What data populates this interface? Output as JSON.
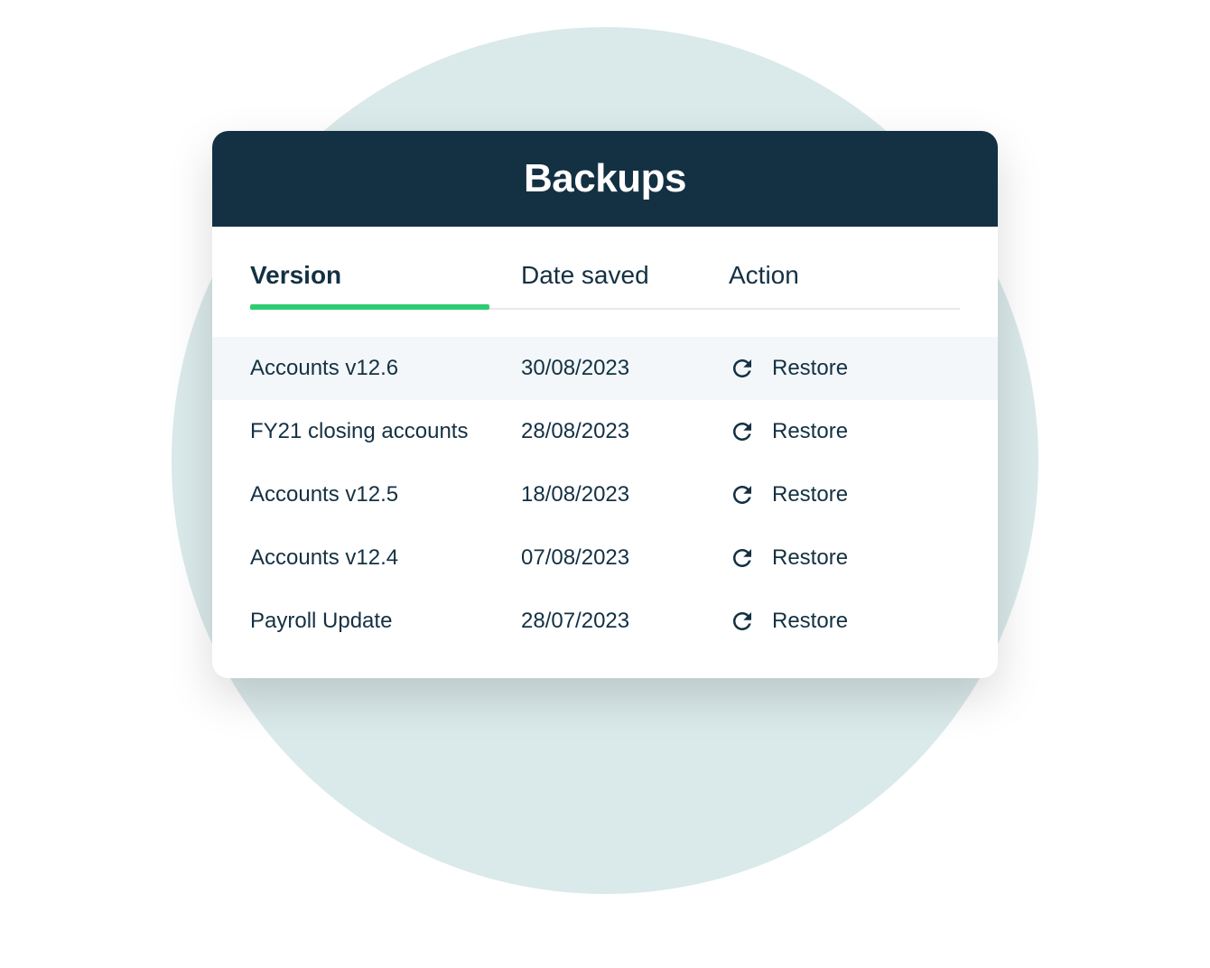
{
  "card": {
    "title": "Backups"
  },
  "table": {
    "columns": {
      "version": "Version",
      "date_saved": "Date saved",
      "action": "Action"
    },
    "active_column": "version",
    "rows": [
      {
        "version": "Accounts v12.6",
        "date": "30/08/2023",
        "action": "Restore",
        "highlighted": true
      },
      {
        "version": "FY21 closing accounts",
        "date": "28/08/2023",
        "action": "Restore",
        "highlighted": false
      },
      {
        "version": "Accounts v12.5",
        "date": "18/08/2023",
        "action": "Restore",
        "highlighted": false
      },
      {
        "version": "Accounts v12.4",
        "date": "07/08/2023",
        "action": "Restore",
        "highlighted": false
      },
      {
        "version": "Payroll Update",
        "date": "28/07/2023",
        "action": "Restore",
        "highlighted": false
      }
    ]
  },
  "colors": {
    "header_bg": "#143143",
    "accent_green": "#2ecc71",
    "circle_bg": "#dae9ea",
    "row_highlight": "#f3f7fa",
    "text": "#143143"
  }
}
